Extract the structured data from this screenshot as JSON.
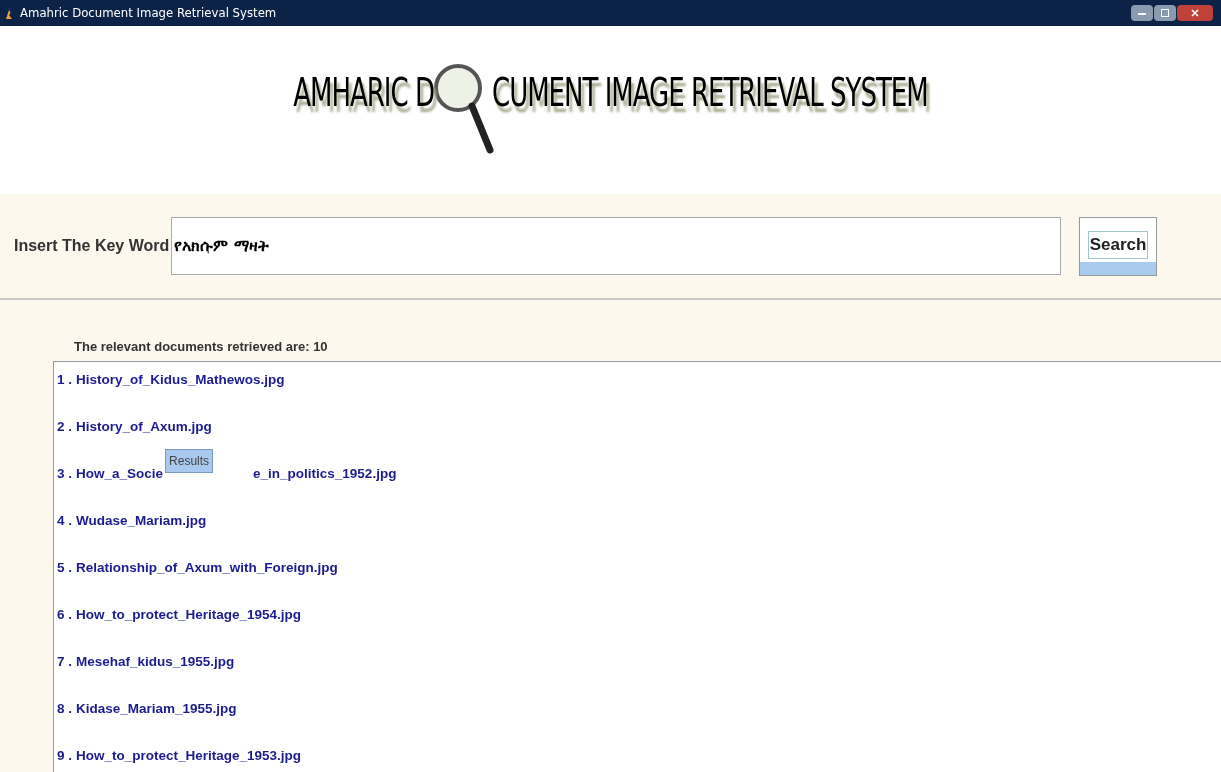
{
  "window": {
    "title": "Amahric Document Image Retrieval System"
  },
  "banner": {
    "before": "AMHARIC D",
    "after": "CUMENT IMAGE RETRIEVAL SYSTEM"
  },
  "search": {
    "label": "Insert The Key Word",
    "value": "የአክሱም ማዛት",
    "button": "Search"
  },
  "results": {
    "summary": "The relevant documents retrieved are: 10",
    "items": [
      {
        "number": "1 .",
        "parts": [
          "History_of_Kidus_Mathewos.jpg"
        ]
      },
      {
        "number": "2 .",
        "parts": [
          "History_of_Axum.jpg"
        ]
      },
      {
        "number": "3 .",
        "parts": [
          "How_a_Socie",
          "e_in_politics_1952.jpg"
        ],
        "tooltip": "Results"
      },
      {
        "number": "4 .",
        "parts": [
          "Wudase_Mariam.jpg"
        ]
      },
      {
        "number": "5 .",
        "parts": [
          "Relationship_of_Axum_with_Foreign.jpg"
        ]
      },
      {
        "number": "6 .",
        "parts": [
          "How_to_protect_Heritage_1954.jpg"
        ]
      },
      {
        "number": "7 .",
        "parts": [
          "Mesehaf_kidus_1955.jpg"
        ]
      },
      {
        "number": "8 .",
        "parts": [
          "Kidase_Mariam_1955.jpg"
        ]
      },
      {
        "number": "9 .",
        "parts": [
          "How_to_protect_Heritage_1953.jpg"
        ]
      }
    ]
  }
}
